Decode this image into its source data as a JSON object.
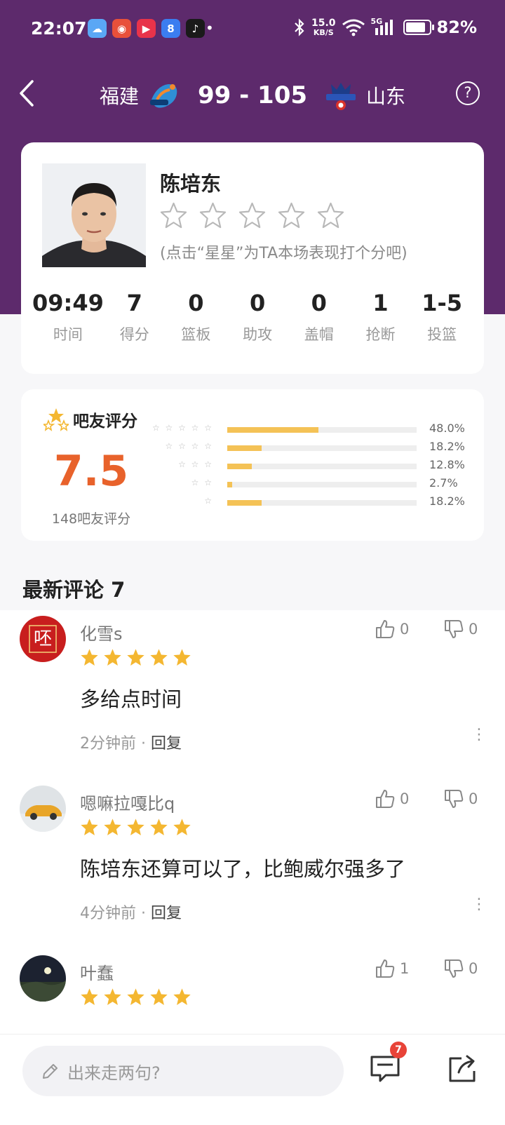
{
  "status_bar": {
    "time": "22:07",
    "net_speed_value": "15.0",
    "net_speed_unit": "KB/S",
    "signal_label": "5G",
    "battery_percent": 82,
    "battery_text": "82%"
  },
  "nav": {
    "home_team": "福建",
    "score": "99 - 105",
    "away_team": "山东",
    "help_label": "?"
  },
  "player": {
    "name": "陈培东",
    "rating_hint": "(点击“星星”为TA本场表现打个分吧)",
    "stats": [
      {
        "value": "09:49",
        "label": "时间"
      },
      {
        "value": "7",
        "label": "得分"
      },
      {
        "value": "0",
        "label": "篮板"
      },
      {
        "value": "0",
        "label": "助攻"
      },
      {
        "value": "0",
        "label": "盖帽"
      },
      {
        "value": "1",
        "label": "抢断"
      },
      {
        "value": "1-5",
        "label": "投篮"
      }
    ]
  },
  "fan_rating": {
    "title": "吧友评分",
    "score": "7.5",
    "count_label": "148吧友评分",
    "distribution": [
      {
        "stars": "☆ ☆ ☆ ☆ ☆",
        "pct_label": "48.0%",
        "fraction": 0.48
      },
      {
        "stars": "☆ ☆ ☆ ☆",
        "pct_label": "18.2%",
        "fraction": 0.182
      },
      {
        "stars": "☆ ☆ ☆",
        "pct_label": "12.8%",
        "fraction": 0.128
      },
      {
        "stars": "☆ ☆",
        "pct_label": "2.7%",
        "fraction": 0.027
      },
      {
        "stars": "☆",
        "pct_label": "18.2%",
        "fraction": 0.182
      }
    ]
  },
  "comments": {
    "title": "最新评论 7",
    "items": [
      {
        "name": "化雪s",
        "text": "多给点时间",
        "time": "2分钟前",
        "reply": "回复",
        "likes": "0",
        "dislikes": "0",
        "rating": 5,
        "avatar_char": "呸"
      },
      {
        "name": "嗯嘛拉嘎比q",
        "text": "陈培东还算可以了，比鲍威尔强多了",
        "time": "4分钟前",
        "reply": "回复",
        "likes": "0",
        "dislikes": "0",
        "rating": 5
      },
      {
        "name": "叶蠢",
        "text": "",
        "time": "",
        "reply": "",
        "likes": "1",
        "dislikes": "0",
        "rating": 5
      }
    ]
  },
  "bottom_bar": {
    "input_placeholder": "出来走两句?",
    "comment_badge": "7"
  },
  "colors": {
    "header_purple": "#5d2a6c",
    "score_orange": "#e8622b",
    "star_gold": "#f4b731",
    "bar_gold": "#f4c256",
    "badge_red": "#e84338"
  }
}
